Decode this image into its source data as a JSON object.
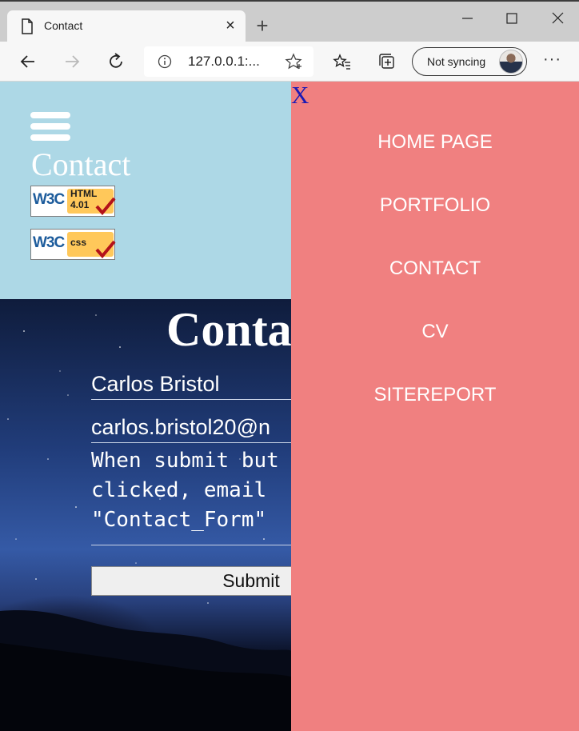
{
  "browser": {
    "tab_title": "Contact",
    "address": "127.0.0.1:...",
    "sync_label": "Not syncing",
    "more_label": "···"
  },
  "header": {
    "site_title": "Contact",
    "badges": [
      {
        "logo": "W3C",
        "label_line1": "HTML",
        "label_line2": "4.01"
      },
      {
        "logo": "W3C",
        "label_line1": "css",
        "label_line2": ""
      }
    ]
  },
  "form": {
    "heading": "Contact",
    "name_value": "Carlos Bristol",
    "email_value": "carlos.bristol20@n",
    "message_value": "When submit but\nclicked, email\n\"Contact_Form\"",
    "submit_label": "Submit"
  },
  "sidenav": {
    "close_label": "X",
    "items": [
      {
        "label": "HOME PAGE"
      },
      {
        "label": "PORTFOLIO"
      },
      {
        "label": "CONTACT"
      },
      {
        "label": "CV"
      },
      {
        "label": "SITEREPORT"
      }
    ]
  },
  "colors": {
    "header_bg": "#add8e6",
    "sidenav_bg": "#f08080",
    "close_x": "#1b1bb5",
    "badge_gold": "#ffc85a"
  }
}
